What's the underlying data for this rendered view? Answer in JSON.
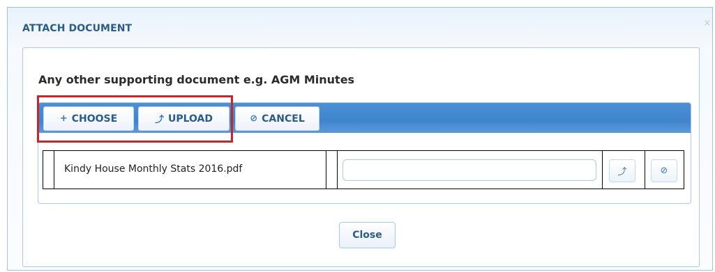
{
  "dialog": {
    "title": "ATTACH DOCUMENT",
    "close_icon": "×"
  },
  "heading": "Any other supporting document e.g. AGM Minutes",
  "toolbar": {
    "choose": {
      "icon": "+",
      "label": "CHOOSE"
    },
    "upload": {
      "icon": "⤴",
      "label": "UPLOAD"
    },
    "cancel": {
      "icon": "⊘",
      "label": "CANCEL"
    }
  },
  "file": {
    "name": "Kindy House Monthly Stats 2016.pdf",
    "progress": 0,
    "upload_icon": "⤴",
    "cancel_icon": "⊘"
  },
  "footer": {
    "close_label": "Close"
  },
  "colors": {
    "accent": "#3f85cc",
    "title_text": "#2a5c8a",
    "highlight": "#c1272d"
  }
}
